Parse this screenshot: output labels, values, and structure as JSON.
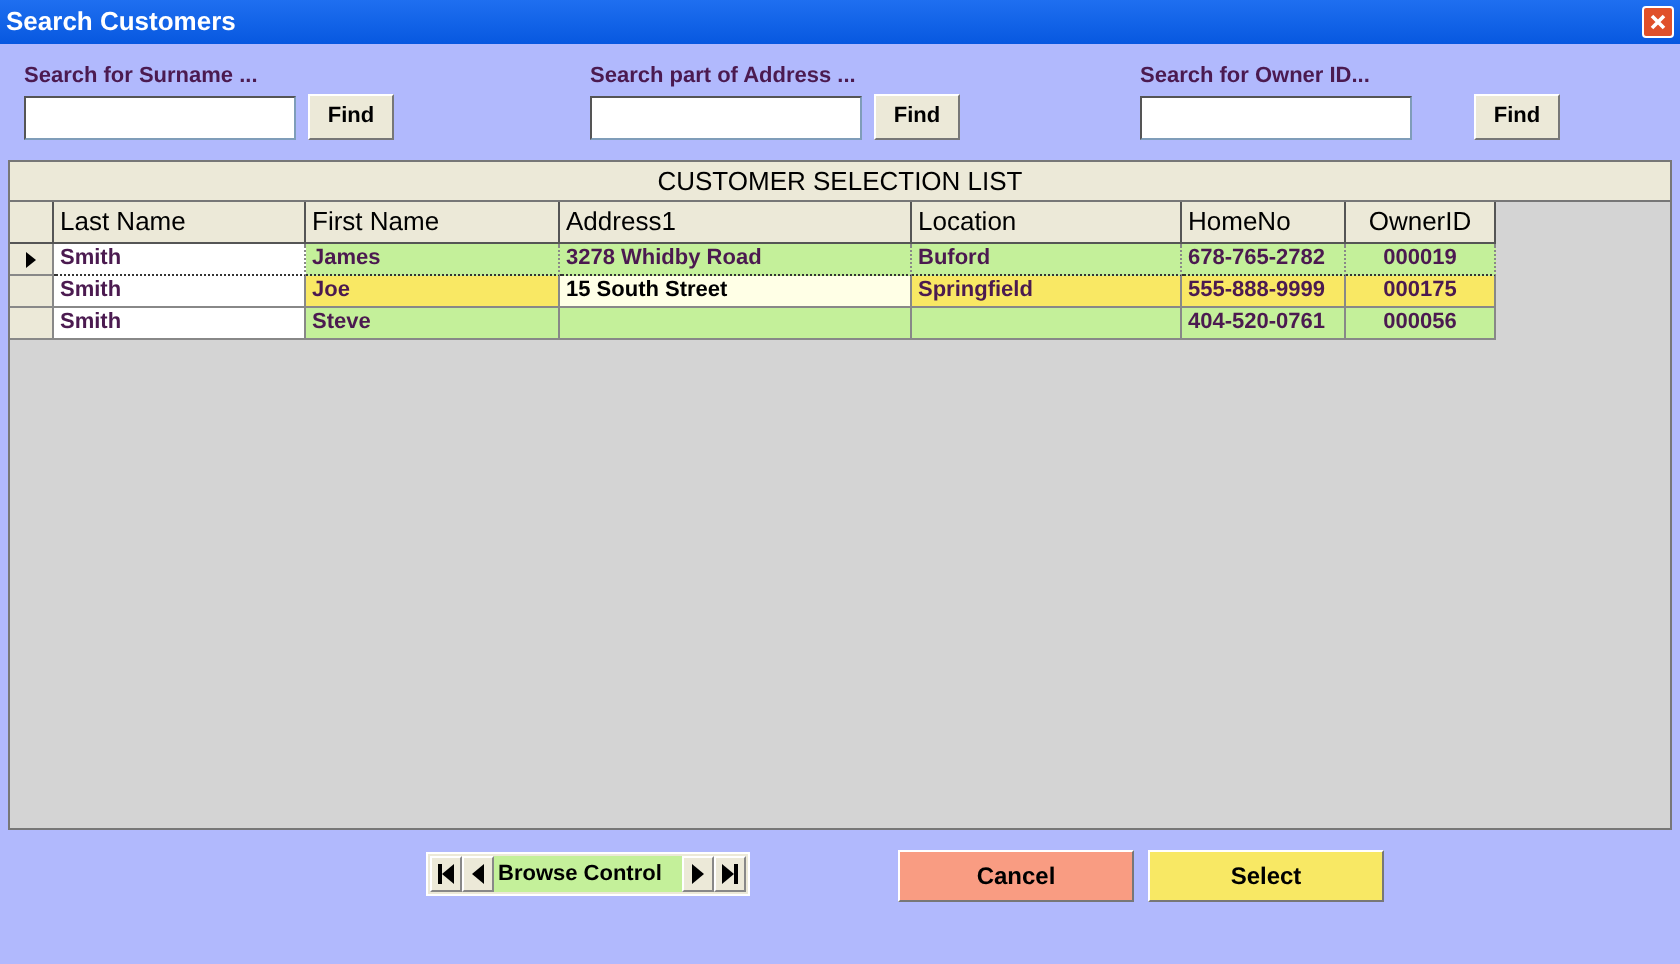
{
  "window": {
    "title": "Search Customers"
  },
  "searches": [
    {
      "label": "Search for Surname ...",
      "button": "Find"
    },
    {
      "label": "Search part of Address ...",
      "button": "Find"
    },
    {
      "label": "Search for Owner ID...",
      "button": "Find"
    }
  ],
  "list": {
    "title": "CUSTOMER SELECTION LIST",
    "columns": [
      "Last Name",
      "First Name",
      "Address1",
      "Location",
      "HomeNo",
      "OwnerID"
    ],
    "rows": [
      {
        "selected": true,
        "color": "#c4f09a",
        "cells": [
          {
            "text": "Smith",
            "focused": false
          },
          {
            "text": "James",
            "focused": false
          },
          {
            "text": "3278 Whidby Road",
            "focused": false
          },
          {
            "text": "Buford",
            "focused": false
          },
          {
            "text": "678-765-2782",
            "focused": false
          },
          {
            "text": "000019",
            "focused": false
          }
        ]
      },
      {
        "selected": false,
        "color": "#f9e864",
        "cells": [
          {
            "text": "Smith",
            "focused": false
          },
          {
            "text": "Joe",
            "focused": false
          },
          {
            "text": "15 South Street",
            "focused": true
          },
          {
            "text": "Springfield",
            "focused": false
          },
          {
            "text": "555-888-9999",
            "focused": false
          },
          {
            "text": "000175",
            "focused": false
          }
        ]
      },
      {
        "selected": false,
        "color": "#c4f09a",
        "cells": [
          {
            "text": "Smith",
            "focused": false
          },
          {
            "text": "Steve",
            "focused": false
          },
          {
            "text": "",
            "focused": false
          },
          {
            "text": "",
            "focused": false
          },
          {
            "text": "404-520-0761",
            "focused": false
          },
          {
            "text": "000056",
            "focused": false
          }
        ]
      }
    ]
  },
  "browse": {
    "label": "Browse Control"
  },
  "buttons": [
    {
      "label": "Cancel",
      "color": "#f99c82"
    },
    {
      "label": "Select",
      "color": "#f8e864"
    }
  ]
}
